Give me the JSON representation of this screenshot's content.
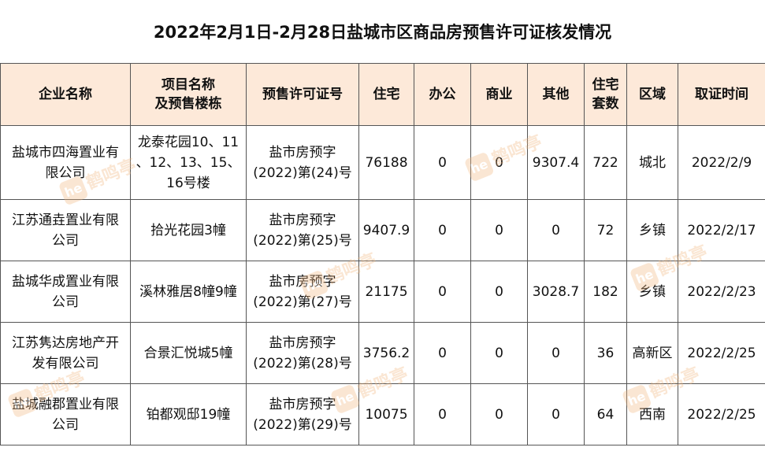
{
  "title": "2022年2月1日-2月28日盐城市区商品房预售许可证核发情况",
  "table": {
    "headers": {
      "company": "企业名称",
      "project_l1": "项目名称",
      "project_l2": "及预售楼栋",
      "permit": "预售许可证号",
      "residential": "住宅",
      "office": "办公",
      "commercial": "商业",
      "other": "其他",
      "units_l1": "住宅",
      "units_l2": "套数",
      "district": "区域",
      "date": "取证时间"
    },
    "rows": [
      {
        "company_l1": "盐城市四海置业有",
        "company_l2": "限公司",
        "project_l1": "龙泰花园10、11",
        "project_l2": "、12、13、15、",
        "project_l3": "16号楼",
        "permit_l1": "盐市房预字",
        "permit_l2": "(2022)第(24)号",
        "residential": "76188",
        "office": "0",
        "commercial": "0",
        "other": "9307.4",
        "units": "722",
        "district": "城北",
        "date": "2022/2/9"
      },
      {
        "company_l1": "江苏通垚置业有限",
        "company_l2": "公司",
        "project_l1": "拾光花园3幢",
        "permit_l1": "盐市房预字",
        "permit_l2": "(2022)第(25)号",
        "residential": "9407.9",
        "office": "0",
        "commercial": "0",
        "other": "0",
        "units": "72",
        "district": "乡镇",
        "date": "2022/2/17"
      },
      {
        "company_l1": "盐城华成置业有限",
        "company_l2": "公司",
        "project_l1": "溪林雅居8幢9幢",
        "permit_l1": "盐市房预字",
        "permit_l2": "(2022)第(27)号",
        "residential": "21175",
        "office": "0",
        "commercial": "0",
        "other": "3028.7",
        "units": "182",
        "district": "乡镇",
        "date": "2022/2/23"
      },
      {
        "company_l1": "江苏隽达房地产开",
        "company_l2": "发有限公司",
        "project_l1": "合景汇悦城5幢",
        "permit_l1": "盐市房预字",
        "permit_l2": "(2022)第(28)号",
        "residential": "3756.2",
        "office": "0",
        "commercial": "0",
        "other": "0",
        "units": "36",
        "district": "高新区",
        "date": "2022/2/25"
      },
      {
        "company_l1": "盐城融郡置业有限",
        "company_l2": "公司",
        "project_l1": "铂都观邸19幢",
        "permit_l1": "盐市房预字",
        "permit_l2": "(2022)第(29)号",
        "residential": "10075",
        "office": "0",
        "commercial": "0",
        "other": "0",
        "units": "64",
        "district": "西南",
        "date": "2022/2/25"
      }
    ]
  },
  "watermark": {
    "text": "鹤鸣亭",
    "logo": "he",
    "color": "#f3b983"
  }
}
